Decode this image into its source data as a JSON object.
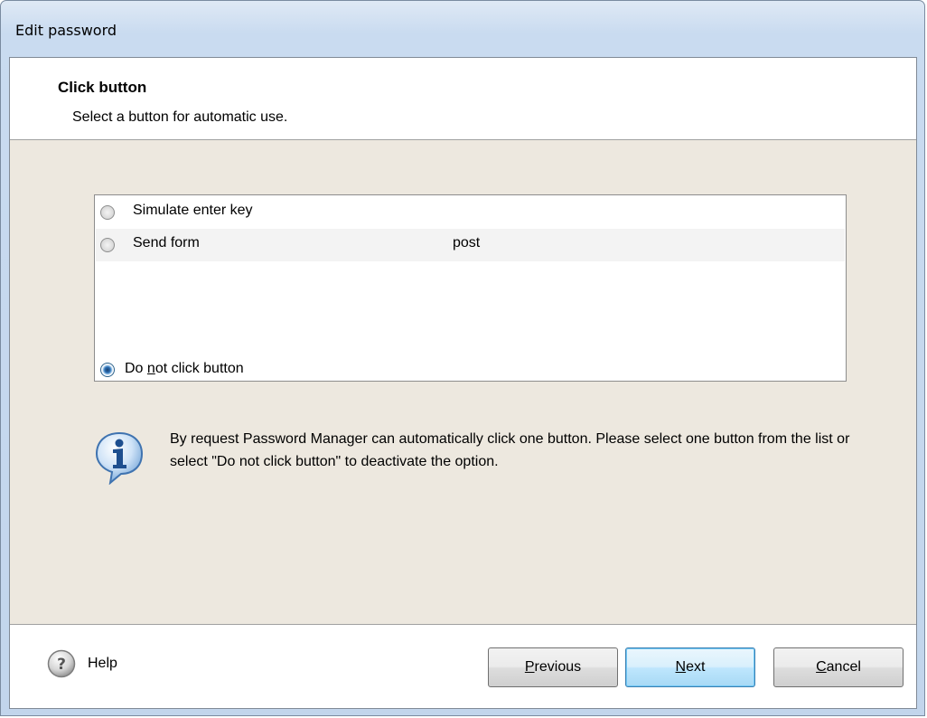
{
  "window": {
    "title": "Edit password"
  },
  "header": {
    "title": "Click button",
    "subtitle": "Select a button for automatic use."
  },
  "button_list": {
    "items": [
      {
        "name": "Simulate enter key",
        "method": "",
        "selected": false
      },
      {
        "name": "Send form",
        "method": "post",
        "selected": false
      }
    ]
  },
  "do_not_click": {
    "label_pre": "Do ",
    "label_mnemonic": "n",
    "label_post": "ot click button",
    "selected": true
  },
  "info": {
    "icon": "info-icon",
    "text": "By request Password Manager can automatically click one button. Please select one button from the list or select \"Do not click button\" to deactivate the option."
  },
  "footer": {
    "help_icon": "help-icon",
    "help_label": "Help",
    "previous": {
      "mnemonic": "P",
      "rest": "revious"
    },
    "next": {
      "mnemonic": "N",
      "rest": "ext"
    },
    "cancel": {
      "mnemonic": "C",
      "rest": "ancel"
    }
  },
  "colors": {
    "body_bg": "#ede8df",
    "window_frame": "#c2d5ec",
    "default_button": "#bee6fd"
  }
}
